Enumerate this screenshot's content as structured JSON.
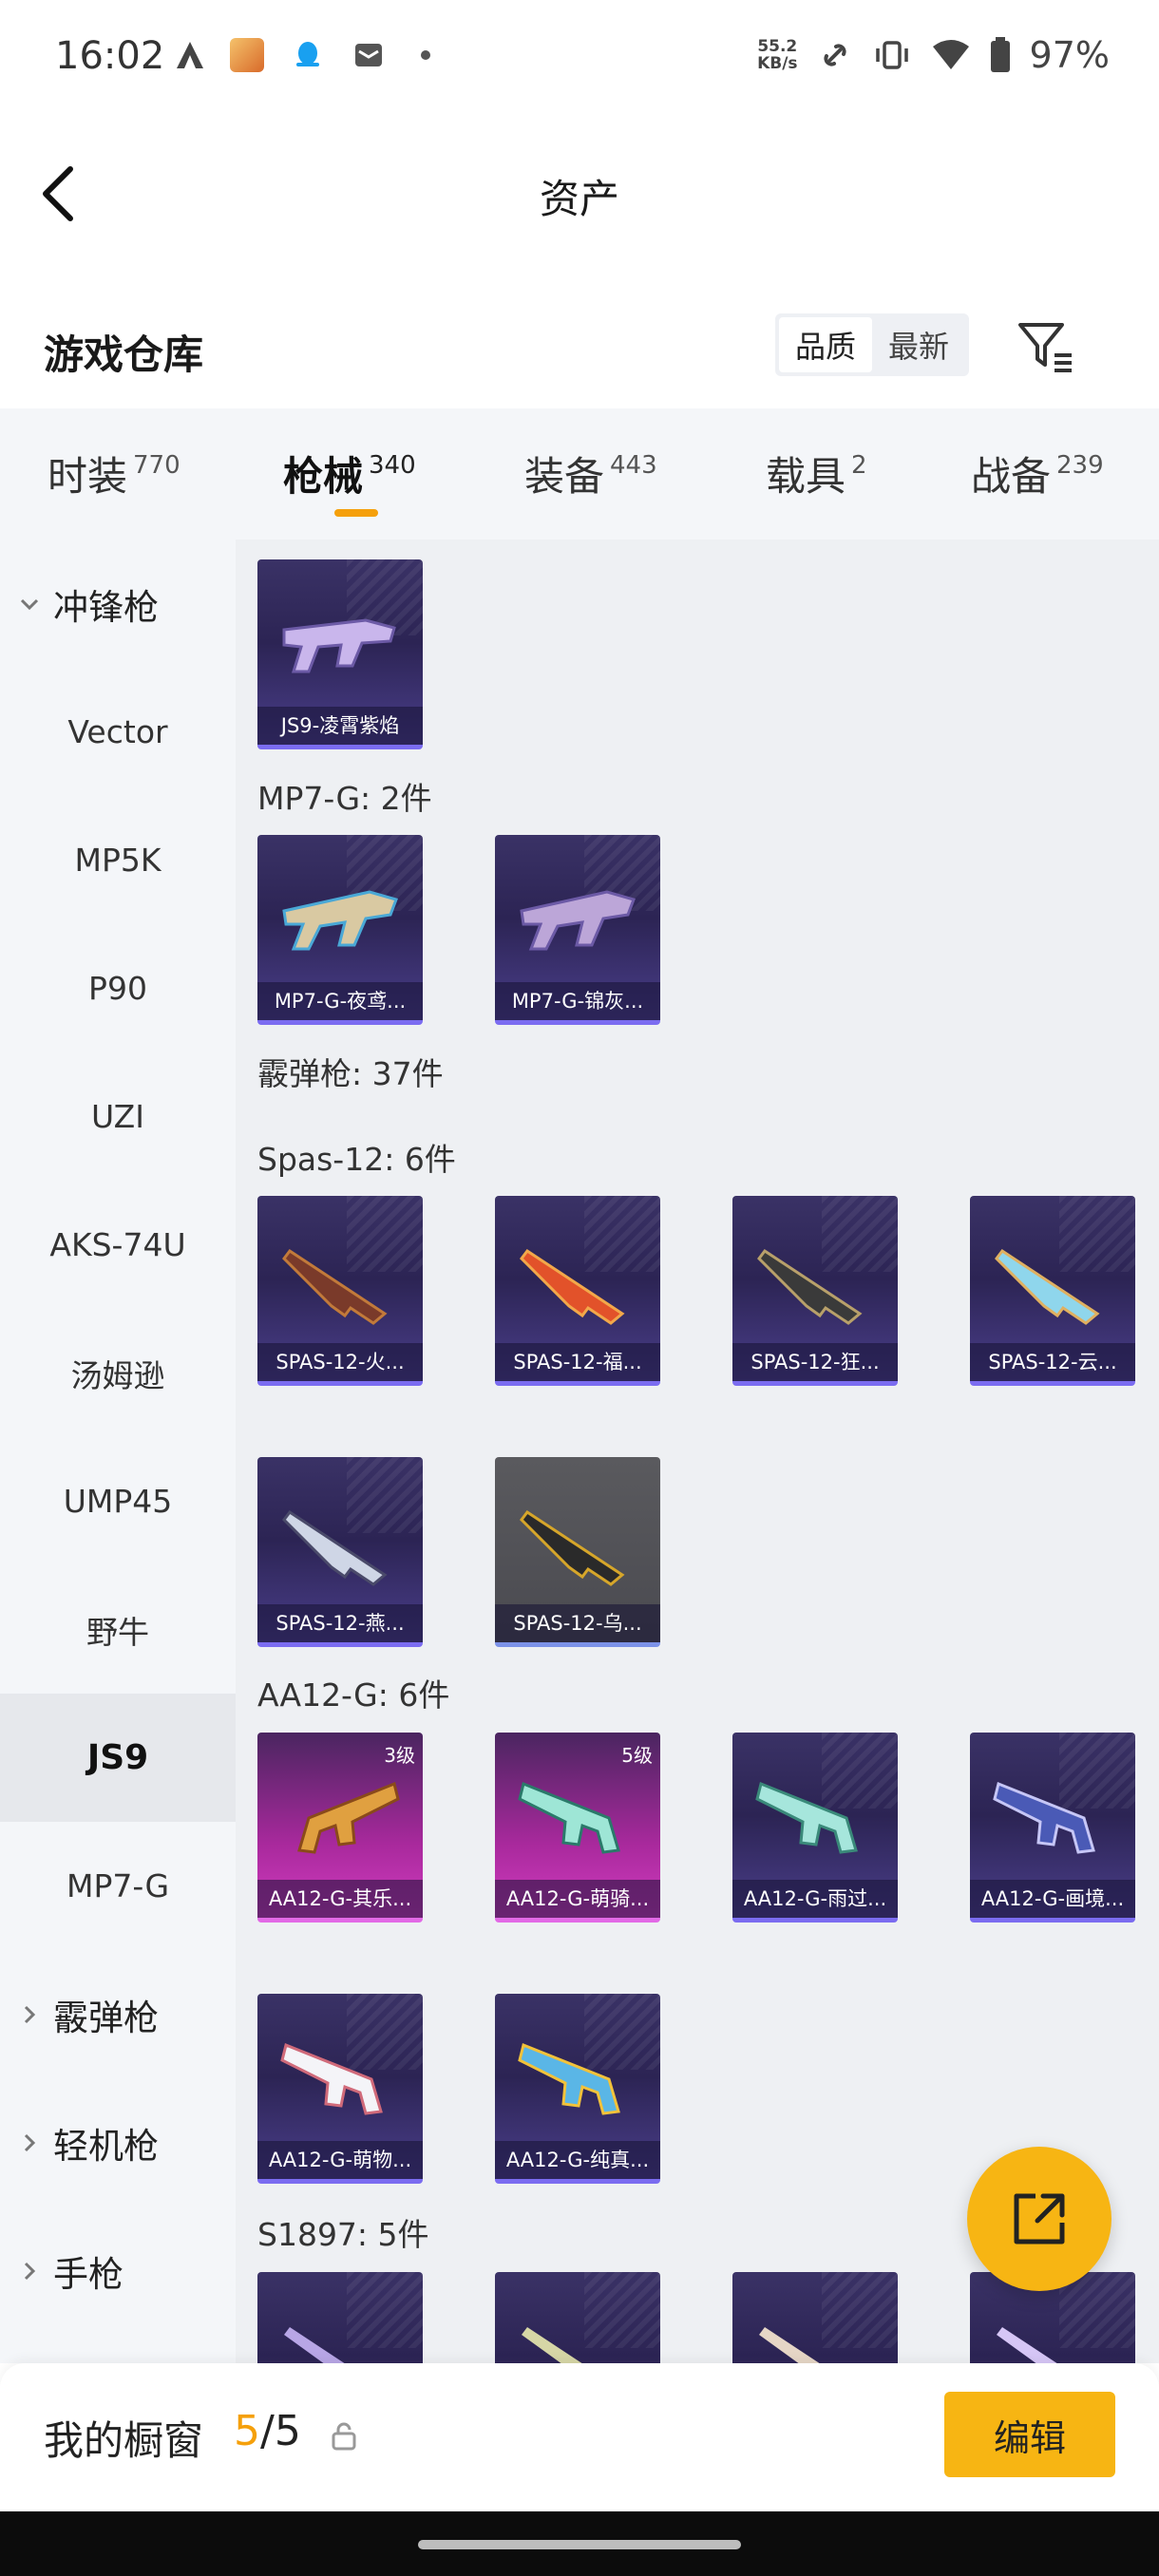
{
  "status_bar": {
    "time": "16:02",
    "speed_value": "55.2",
    "speed_unit": "KB/s",
    "battery": "97%"
  },
  "header": {
    "title": "资产"
  },
  "section": {
    "title": "游戏仓库",
    "sort_quality": "品质",
    "sort_newest": "最新"
  },
  "tabs": [
    {
      "label": "时装",
      "count": "770"
    },
    {
      "label": "枪械",
      "count": "340"
    },
    {
      "label": "装备",
      "count": "443"
    },
    {
      "label": "载具",
      "count": "2"
    },
    {
      "label": "战备",
      "count": "239"
    }
  ],
  "sidebar": {
    "items": [
      {
        "label": "冲锋枪"
      },
      {
        "label": "Vector"
      },
      {
        "label": "MP5K"
      },
      {
        "label": "P90"
      },
      {
        "label": "UZI"
      },
      {
        "label": "AKS-74U"
      },
      {
        "label": "汤姆逊"
      },
      {
        "label": "UMP45"
      },
      {
        "label": "野牛"
      },
      {
        "label": "JS9"
      },
      {
        "label": "MP7-G"
      },
      {
        "label": "霰弹枪"
      },
      {
        "label": "轻机枪"
      },
      {
        "label": "手枪"
      }
    ]
  },
  "groups": {
    "mp7": "MP7-G: 2件",
    "shotgun": "霰弹枪: 37件",
    "spas": "Spas-12: 6件",
    "aa12": "AA12-G: 6件",
    "s1897": "S1897: 5件"
  },
  "cards": [
    {
      "name": "JS9-凌霄紫焰"
    },
    {
      "name": "MP7-G-夜鸢..."
    },
    {
      "name": "MP7-G-锦灰..."
    },
    {
      "name": "SPAS-12-火..."
    },
    {
      "name": "SPAS-12-福..."
    },
    {
      "name": "SPAS-12-狂..."
    },
    {
      "name": "SPAS-12-云..."
    },
    {
      "name": "SPAS-12-燕..."
    },
    {
      "name": "SPAS-12-乌..."
    },
    {
      "name": "AA12-G-其乐...",
      "level": "3级"
    },
    {
      "name": "AA12-G-萌骑...",
      "level": "5级"
    },
    {
      "name": "AA12-G-雨过..."
    },
    {
      "name": "AA12-G-画境..."
    },
    {
      "name": "AA12-G-萌物..."
    },
    {
      "name": "AA12-G-纯真..."
    }
  ],
  "bottom_bar": {
    "label": "我的橱窗",
    "current": "5",
    "separator_total": "/5",
    "edit_label": "编辑"
  },
  "colors": {
    "accent": "#f7b513",
    "tab_indicator": "#f5a00b"
  }
}
